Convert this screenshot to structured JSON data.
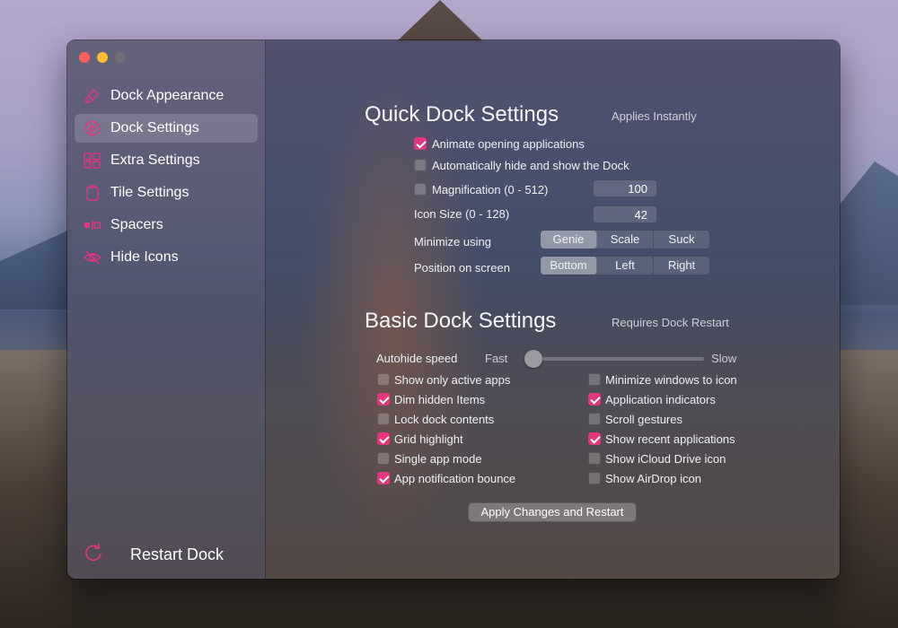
{
  "sidebar": {
    "items": [
      {
        "label": "Dock Appearance",
        "icon": "brush-icon",
        "active": false
      },
      {
        "label": "Dock Settings",
        "icon": "dock-settings-icon",
        "active": true
      },
      {
        "label": "Extra Settings",
        "icon": "grid-icon",
        "active": false
      },
      {
        "label": "Tile Settings",
        "icon": "tile-icon",
        "active": false
      },
      {
        "label": "Spacers",
        "icon": "spacer-icon",
        "active": false
      },
      {
        "label": "Hide Icons",
        "icon": "eye-slash-icon",
        "active": false
      }
    ],
    "restart_label": "Restart Dock"
  },
  "quick": {
    "title": "Quick Dock Settings",
    "note": "Applies Instantly",
    "animate_label": "Animate opening applications",
    "animate_checked": true,
    "autohide_label": "Automatically hide and show the Dock",
    "autohide_checked": false,
    "magnification_label": "Magnification (0 - 512)",
    "magnification_checked": false,
    "magnification_value": "100",
    "iconsize_label": "Icon Size (0 - 128)",
    "iconsize_value": "42",
    "minimize_label": "Minimize using",
    "minimize_options": [
      "Genie",
      "Scale",
      "Suck"
    ],
    "minimize_selected": "Genie",
    "position_label": "Position on screen",
    "position_options": [
      "Bottom",
      "Left",
      "Right"
    ],
    "position_selected": "Bottom"
  },
  "basic": {
    "title": "Basic Dock Settings",
    "note": "Requires Dock Restart",
    "autohide_speed_label": "Autohide speed",
    "fast_label": "Fast",
    "slow_label": "Slow",
    "autohide_speed_fraction": 0.0,
    "left_options": [
      {
        "label": "Show only active apps",
        "checked": false
      },
      {
        "label": "Dim hidden Items",
        "checked": true
      },
      {
        "label": "Lock dock contents",
        "checked": false
      },
      {
        "label": "Grid highlight",
        "checked": true
      },
      {
        "label": "Single app mode",
        "checked": false
      },
      {
        "label": "App notification bounce",
        "checked": true
      }
    ],
    "right_options": [
      {
        "label": "Minimize windows to icon",
        "checked": false
      },
      {
        "label": "Application indicators",
        "checked": true
      },
      {
        "label": "Scroll gestures",
        "checked": false
      },
      {
        "label": "Show recent applications",
        "checked": true
      },
      {
        "label": "Show iCloud Drive icon",
        "checked": false
      },
      {
        "label": "Show AirDrop icon",
        "checked": false
      }
    ],
    "apply_label": "Apply Changes and Restart"
  },
  "colors": {
    "accent": "#e2367d",
    "close": "#ff5f57",
    "minimize": "#febc2e"
  }
}
